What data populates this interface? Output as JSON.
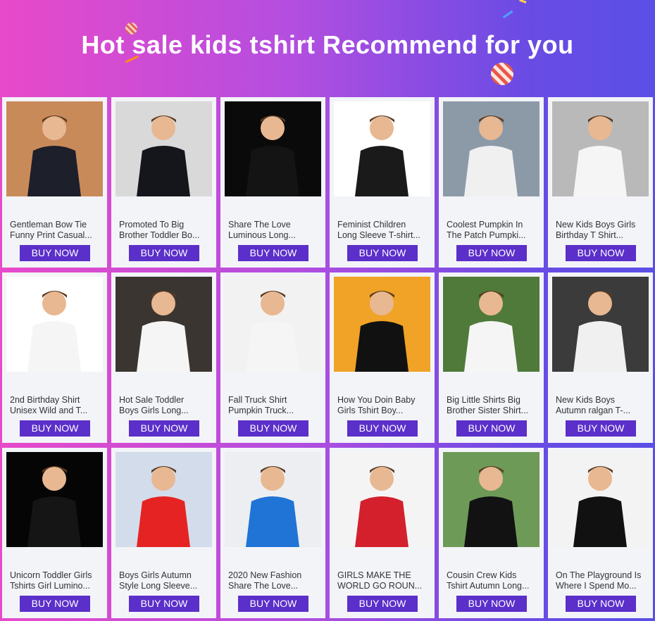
{
  "banner": {
    "title": "Hot sale kids tshirt Recommend for you"
  },
  "buy_label": "BUY NOW",
  "products": [
    {
      "line1": "Gentleman Bow Tie",
      "line2": "Funny Print Casual...",
      "bg": "#c98a5a",
      "shirt": "#1d1f2a"
    },
    {
      "line1": "Promoted To Big",
      "line2": "Brother Toddler Bo...",
      "bg": "#d9d9d9",
      "shirt": "#15161c"
    },
    {
      "line1": "Share The Love",
      "line2": "Luminous Long...",
      "bg": "#0a0a0a",
      "shirt": "#141414"
    },
    {
      "line1": "Feminist Children",
      "line2": "Long Sleeve T-shirt...",
      "bg": "#ffffff",
      "shirt": "#1a1a1a"
    },
    {
      "line1": "Coolest Pumpkin In",
      "line2": "The Patch Pumpki...",
      "bg": "#8c9aa8",
      "shirt": "#f0f0f0"
    },
    {
      "line1": "New Kids Boys Girls",
      "line2": "Birthday T Shirt...",
      "bg": "#b9b9b9",
      "shirt": "#f5f5f5"
    },
    {
      "line1": "2nd Birthday Shirt",
      "line2": "Unisex Wild and T...",
      "bg": "#ffffff",
      "shirt": "#f5f5f5"
    },
    {
      "line1": "Hot Sale Toddler",
      "line2": "Boys Girls Long...",
      "bg": "#3a3530",
      "shirt": "#f5f5f5"
    },
    {
      "line1": "Fall Truck Shirt",
      "line2": "Pumpkin Truck...",
      "bg": "#f2f2f2",
      "shirt": "#f5f5f5"
    },
    {
      "line1": "How You Doin Baby",
      "line2": "Girls Tshirt Boy...",
      "bg": "#f0a326",
      "shirt": "#111111"
    },
    {
      "line1": "Big Little Shirts Big",
      "line2": "Brother Sister Shirt...",
      "bg": "#4f7a3a",
      "shirt": "#f5f5f5"
    },
    {
      "line1": "New Kids Boys",
      "line2": "Autumn ralgan T-...",
      "bg": "#3b3b3b",
      "shirt": "#f0f0f0"
    },
    {
      "line1": "Unicorn Toddler Girls",
      "line2": "Tshirts Girl Lumino...",
      "bg": "#050505",
      "shirt": "#151515"
    },
    {
      "line1": "Boys Girls Autumn",
      "line2": "Style Long Sleeve...",
      "bg": "#d3dcea",
      "shirt": "#e52323"
    },
    {
      "line1": "2020 New Fashion",
      "line2": "Share The Love...",
      "bg": "#eceef2",
      "shirt": "#1f74d6"
    },
    {
      "line1": "GIRLS MAKE THE",
      "line2": "WORLD GO ROUN...",
      "bg": "#f4f4f4",
      "shirt": "#d4202c"
    },
    {
      "line1": "Cousin Crew Kids",
      "line2": "Tshirt Autumn Long...",
      "bg": "#6e9a57",
      "shirt": "#121212"
    },
    {
      "line1": "On The Playground Is",
      "line2": "Where I Spend Mo...",
      "bg": "#f3f3f3",
      "shirt": "#111111"
    }
  ]
}
